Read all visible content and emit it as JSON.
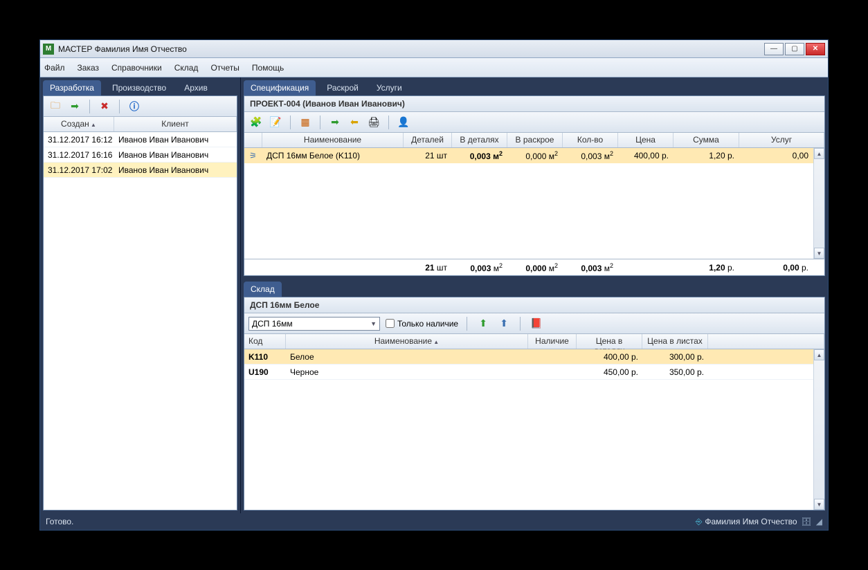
{
  "window": {
    "title": "МАСТЕР Фамилия Имя Отчество"
  },
  "menu": {
    "items": [
      "Файл",
      "Заказ",
      "Справочники",
      "Склад",
      "Отчеты",
      "Помощь"
    ]
  },
  "left_tabs": [
    "Разработка",
    "Производство",
    "Архив"
  ],
  "left_tabs_active": 0,
  "orders": {
    "columns": [
      "Создан",
      "Клиент"
    ],
    "rows": [
      {
        "created": "31.12.2017 16:12",
        "client": "Иванов Иван Иванович"
      },
      {
        "created": "31.12.2017 16:16",
        "client": "Иванов Иван Иванович"
      },
      {
        "created": "31.12.2017 17:02",
        "client": "Иванов Иван Иванович"
      }
    ],
    "selected": 2
  },
  "spec_tabs": [
    "Спецификация",
    "Раскрой",
    "Услуги"
  ],
  "spec_tabs_active": 0,
  "project_title": "ПРОЕКТ-004 (Иванов Иван Иванович)",
  "spec": {
    "columns": [
      "Наименование",
      "Деталей",
      "В деталях",
      "В раскрое",
      "Кол-во",
      "Цена",
      "Сумма",
      "Услуг"
    ],
    "row": {
      "name": "ДСП 16мм Белое (K110)",
      "details": "21 шт",
      "in_details": "0,003 м²",
      "in_cut": "0,000 м²",
      "qty": "0,003 м²",
      "price": "400,00 р.",
      "sum": "1,20 р.",
      "service": "0,00"
    },
    "totals": {
      "details": "21 шт",
      "in_details": "0,003 м²",
      "in_cut": "0,000 м²",
      "qty": "0,003 м²",
      "sum": "1,20 р.",
      "service": "0,00 р."
    }
  },
  "stock_tab": "Склад",
  "stock_title": "ДСП 16мм Белое",
  "stock_filter": {
    "combo": "ДСП 16мм",
    "only_avail": "Только наличие"
  },
  "stock": {
    "columns": [
      "Код",
      "Наименование",
      "Наличие",
      "Цена в деталях",
      "Цена в листах"
    ],
    "rows": [
      {
        "code": "K110",
        "name": "Белое",
        "avail": "",
        "pdet": "400,00 р.",
        "plist": "300,00 р."
      },
      {
        "code": "U190",
        "name": "Черное",
        "avail": "",
        "pdet": "450,00 р.",
        "plist": "350,00 р."
      }
    ],
    "selected": 0
  },
  "status": {
    "left": "Готово.",
    "user": "Фамилия Имя Отчество"
  }
}
